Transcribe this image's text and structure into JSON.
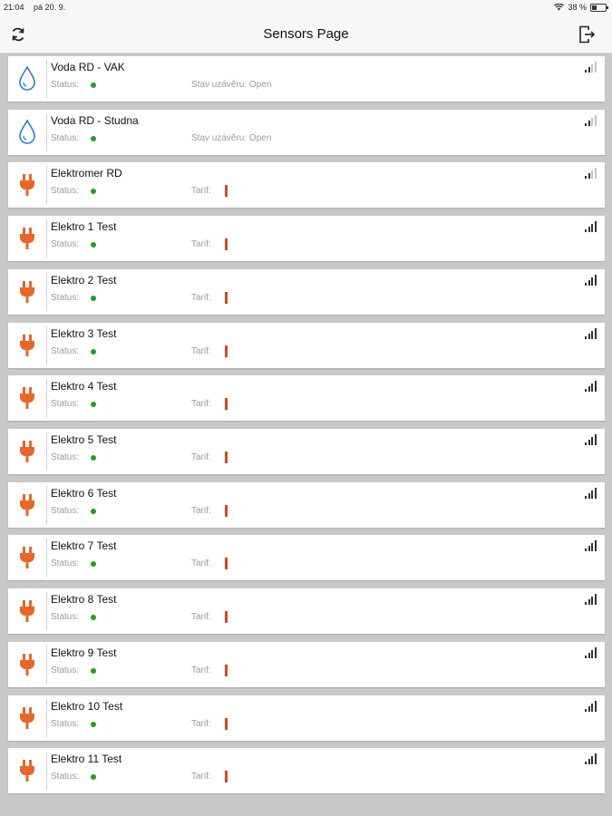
{
  "status_bar": {
    "time": "21:04",
    "date": "pá 20. 9.",
    "battery": "38 %"
  },
  "nav": {
    "title": "Sensors Page",
    "refresh_icon": "refresh-icon",
    "logout_icon": "logout-icon"
  },
  "colors": {
    "status_green": "#1fa01f",
    "tarif_red": "#d64a1c",
    "water_blue": "#2b7bd8",
    "electric_orange": "#e8662a"
  },
  "sensors": [
    {
      "name": "Voda RD - VAK",
      "type": "water",
      "status_label": "Status:",
      "detail": "Stav uzávěru: Open",
      "signal": "weak"
    },
    {
      "name": "Voda RD - Studna",
      "type": "water",
      "status_label": "Status:",
      "detail": "Stav uzávěru: Open",
      "signal": "weak"
    },
    {
      "name": "Elektromer RD",
      "type": "electric",
      "status_label": "Status:",
      "detail": "Tarif:",
      "signal": "weak"
    },
    {
      "name": "Elektro 1 Test",
      "type": "electric",
      "status_label": "Status:",
      "detail": "Tarif:",
      "signal": "full"
    },
    {
      "name": "Elektro 2 Test",
      "type": "electric",
      "status_label": "Status:",
      "detail": "Tarif:",
      "signal": "full"
    },
    {
      "name": "Elektro 3 Test",
      "type": "electric",
      "status_label": "Status:",
      "detail": "Tarif:",
      "signal": "full"
    },
    {
      "name": "Elektro 4 Test",
      "type": "electric",
      "status_label": "Status:",
      "detail": "Tarif:",
      "signal": "full"
    },
    {
      "name": "Elektro 5 Test",
      "type": "electric",
      "status_label": "Status:",
      "detail": "Tarif:",
      "signal": "full"
    },
    {
      "name": "Elektro 6 Test",
      "type": "electric",
      "status_label": "Status:",
      "detail": "Tarif:",
      "signal": "full"
    },
    {
      "name": "Elektro 7 Test",
      "type": "electric",
      "status_label": "Status:",
      "detail": "Tarif:",
      "signal": "full"
    },
    {
      "name": "Elektro 8 Test",
      "type": "electric",
      "status_label": "Status:",
      "detail": "Tarif:",
      "signal": "full"
    },
    {
      "name": "Elektro 9 Test",
      "type": "electric",
      "status_label": "Status:",
      "detail": "Tarif:",
      "signal": "full"
    },
    {
      "name": "Elektro 10 Test",
      "type": "electric",
      "status_label": "Status:",
      "detail": "Tarif:",
      "signal": "full"
    },
    {
      "name": "Elektro 11 Test",
      "type": "electric",
      "status_label": "Status:",
      "detail": "Tarif:",
      "signal": "full"
    }
  ]
}
